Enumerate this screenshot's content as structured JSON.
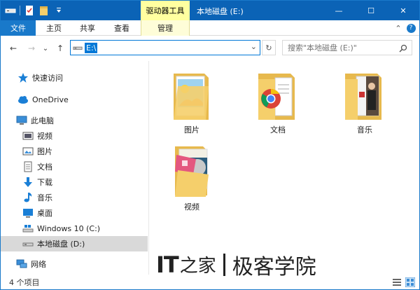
{
  "titlebar": {
    "context_tab": "驱动器工具",
    "title": "本地磁盘 (E:)",
    "minimize": "—",
    "maximize": "☐",
    "close": "✕"
  },
  "ribbon": {
    "tabs": [
      "文件",
      "主页",
      "共享",
      "查看",
      "管理"
    ],
    "collapse": "⌃",
    "help": "?"
  },
  "address": {
    "back": "←",
    "forward": "→",
    "up_recent": "⌄",
    "up": "↑",
    "path": "E:\\",
    "dropdown": "⌄",
    "refresh": "↻",
    "search_placeholder": "搜索\"本地磁盘 (E:)\""
  },
  "nav": {
    "quick_access": "快速访问",
    "onedrive": "OneDrive",
    "this_pc": "此电脑",
    "items": [
      "视频",
      "图片",
      "文档",
      "下载",
      "音乐",
      "桌面"
    ],
    "drive_c": "Windows 10 (C:)",
    "drive_d": "本地磁盘 (D:)",
    "network": "网络"
  },
  "content": {
    "folders": [
      "图片",
      "文档",
      "音乐",
      "视频"
    ]
  },
  "status": {
    "count": "4 个项目"
  },
  "watermark": {
    "it": "IT",
    "logo_char": "之家",
    "text": "极客学院"
  },
  "colors": {
    "titlebar": "#0b63b6",
    "accent": "#1979ca",
    "context": "#ffffa0",
    "folder": "#f5cf6b"
  }
}
